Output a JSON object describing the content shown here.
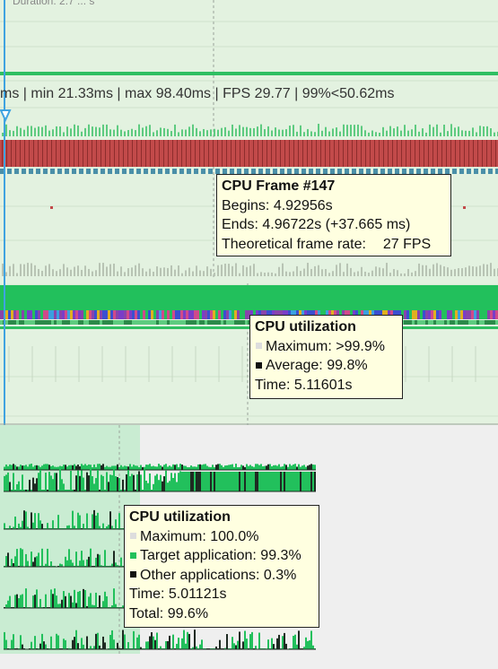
{
  "header": {
    "truncated_label": "Duration: 2.7 ... s"
  },
  "frame_summary": "ms | min 21.33ms | max 98.40ms | FPS 29.77 | 99%<50.62ms",
  "frame_tooltip": {
    "title": "CPU Frame #147",
    "begins": "Begins: 4.92956s",
    "ends": "Ends: 4.96722s (+37.665 ms)",
    "rate_label": "Theoretical frame rate:",
    "rate_value": "27 FPS"
  },
  "cpu_tooltip_main": {
    "title": "CPU utilization",
    "maximum": "Maximum: >99.9%",
    "average": "Average: 99.8%",
    "time": "Time: 5.11601s"
  },
  "cpu_tooltip_lower": {
    "title": "CPU utilization",
    "maximum": "Maximum: 100.0%",
    "target": "Target application: 99.3%",
    "other": "Other applications: 0.3%",
    "time": "Time: 5.01121s",
    "total": "Total: 99.6%"
  },
  "colors": {
    "background": "#e3f2e0",
    "frame_bars": "#c24a4a",
    "cpu_green": "#22c05c",
    "dark_usage": "#1e2a22",
    "tooltip_bg": "#ffffe0",
    "cursor": "#3fa3e0"
  },
  "icons": [
    "timeline-marker-icon"
  ]
}
